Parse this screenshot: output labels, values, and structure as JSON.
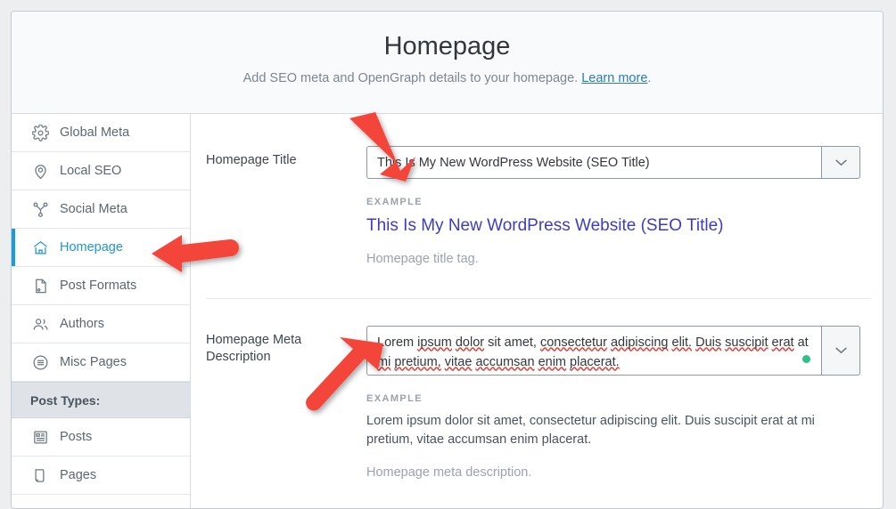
{
  "header": {
    "title": "Homepage",
    "subtitle_before": "Add SEO meta and OpenGraph details to your homepage. ",
    "link_label": "Learn more",
    "subtitle_after": "."
  },
  "sidebar": {
    "items": [
      {
        "label": "Global Meta",
        "icon": "gear-icon",
        "active": false
      },
      {
        "label": "Local SEO",
        "icon": "map-pin-icon",
        "active": false
      },
      {
        "label": "Social Meta",
        "icon": "share-network-icon",
        "active": false
      },
      {
        "label": "Homepage",
        "icon": "home-icon",
        "active": true
      },
      {
        "label": "Post Formats",
        "icon": "document-badge-icon",
        "active": false
      },
      {
        "label": "Authors",
        "icon": "users-icon",
        "active": false
      },
      {
        "label": "Misc Pages",
        "icon": "list-circle-icon",
        "active": false
      }
    ],
    "section_label": "Post Types:",
    "post_types": [
      {
        "label": "Posts",
        "icon": "posts-icon"
      },
      {
        "label": "Pages",
        "icon": "page-icon"
      }
    ]
  },
  "fields": {
    "title": {
      "label": "Homepage Title",
      "value": "This Is My New WordPress Website (SEO Title)",
      "example_label": "EXAMPLE",
      "example_value": "This Is My New WordPress Website (SEO Title)",
      "help": "Homepage title tag.",
      "dropdown_icon": "chevron-down-icon"
    },
    "description": {
      "label": "Homepage Meta Description",
      "value_line1": "Lorem ipsum dolor sit amet, consectetur adipiscing elit. Duis suscipit erat at",
      "value_line2": "mi pretium, vitae accumsan enim placerat.",
      "value": "Lorem ipsum dolor sit amet, consectetur adipiscing elit. Duis suscipit erat at mi pretium, vitae accumsan enim placerat.",
      "example_label": "EXAMPLE",
      "example_value": "Lorem ipsum dolor sit amet, consectetur adipiscing elit. Duis suscipit erat at mi pretium, vitae accumsan enim placerat.",
      "help": "Homepage meta description.",
      "dropdown_icon": "chevron-down-icon",
      "status_dot_color": "#2cc185"
    }
  },
  "annotations": {
    "arrow_color": "#f4443a",
    "arrows": [
      {
        "name": "arrow-to-title-input",
        "direction": "down-right"
      },
      {
        "name": "arrow-to-homepage-nav",
        "direction": "left"
      },
      {
        "name": "arrow-to-description-input",
        "direction": "up-right"
      }
    ]
  },
  "colors": {
    "accent_blue": "#2196d3",
    "link_blue": "#2a7bbd",
    "example_title": "#3c3cc8",
    "green_dot": "#2cc185",
    "arrow_red": "#f4443a"
  }
}
